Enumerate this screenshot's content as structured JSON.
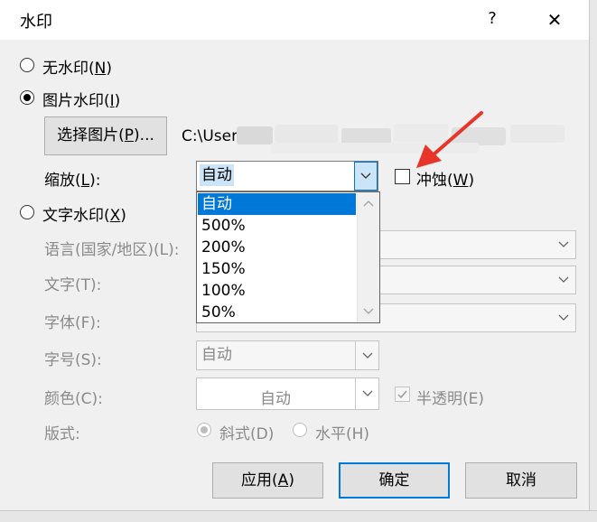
{
  "dialog": {
    "title": "水印",
    "help": "?",
    "close": "✕"
  },
  "options": {
    "none": {
      "label": "无水印(",
      "mnemonic": "N",
      "suffix": ")"
    },
    "picture": {
      "label": "图片水印(",
      "mnemonic": "I",
      "suffix": ")"
    },
    "text": {
      "label": "文字水印(",
      "mnemonic": "X",
      "suffix": ")"
    }
  },
  "picture_section": {
    "select_button": {
      "label": "选择图片(",
      "mnemonic": "P",
      "suffix": ")..."
    },
    "path": "C:\\User",
    "scale_label": {
      "label": "缩放(",
      "mnemonic": "L",
      "suffix": "):"
    },
    "scale_value": "自动",
    "washout": {
      "label": "冲蚀(",
      "mnemonic": "W",
      "suffix": ")",
      "checked": false
    }
  },
  "scale_dropdown": {
    "items": [
      "自动",
      "500%",
      "200%",
      "150%",
      "100%",
      "50%"
    ],
    "selected_index": 0
  },
  "text_section": {
    "language_label": "语言(国家/地区)(L):",
    "text_label": "文字(T):",
    "font_label": "字体(F):",
    "size_label": "字号(S):",
    "size_value": "自动",
    "color_label": "颜色(C):",
    "color_value": "自动",
    "semitransparent_label": "半透明(E)",
    "semitransparent_checked": true,
    "layout_label": "版式:",
    "diagonal_label": "斜式(D)",
    "horizontal_label": "水平(H)"
  },
  "buttons": {
    "apply": {
      "label": "应用(",
      "mnemonic": "A",
      "suffix": ")"
    },
    "ok": "确定",
    "cancel": "取消"
  },
  "colors": {
    "accent": "#0078d7",
    "annotation_arrow": "#e8352a"
  }
}
